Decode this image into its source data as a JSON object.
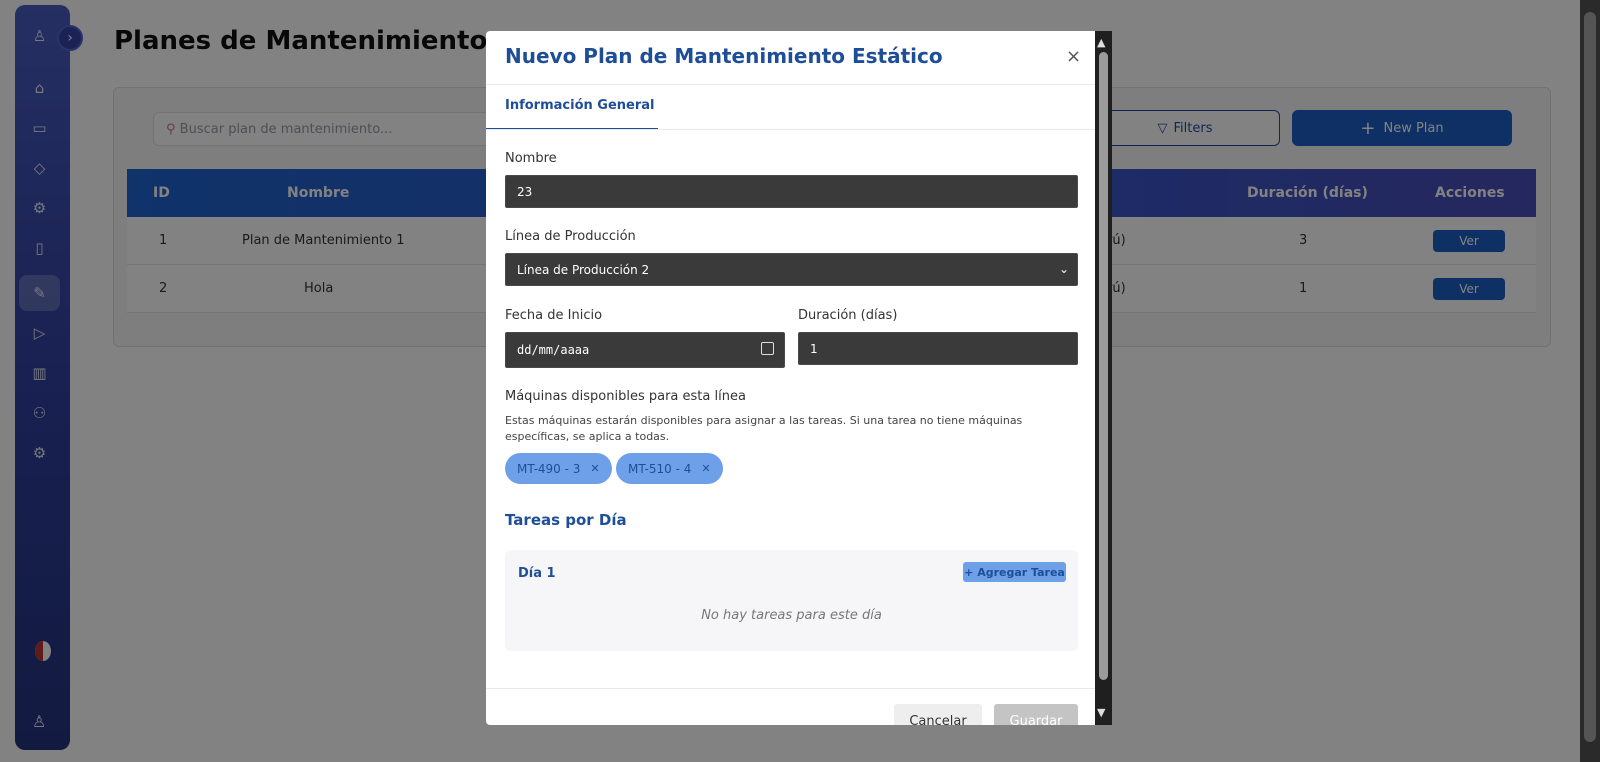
{
  "page": {
    "title": "Planes de Mantenimiento"
  },
  "toolbar": {
    "search_placeholder": "Buscar plan de mantenimiento...",
    "filters_label": "Filters",
    "new_plan_label": "New Plan"
  },
  "table": {
    "columns": [
      "ID",
      "Nombre",
      "Duración (días)",
      "Acciones"
    ],
    "rows": [
      {
        "id": "1",
        "name": "Plan de Mantenimiento 1",
        "partial": "rú)",
        "duration": "3",
        "action": "Ver"
      },
      {
        "id": "2",
        "name": "Hola",
        "partial": "rú)",
        "duration": "1",
        "action": "Ver"
      }
    ]
  },
  "modal": {
    "title": "Nuevo Plan de Mantenimiento Estático",
    "close": "×",
    "tab": "Información General",
    "name_label": "Nombre",
    "name_value": "23",
    "line_label": "Línea de Producción",
    "line_value": "Línea de Producción 2",
    "start_label": "Fecha de Inicio",
    "start_placeholder": "dd/mm/aaaa",
    "duration_label": "Duración (días)",
    "duration_value": "1",
    "machines_label": "Máquinas disponibles para esta línea",
    "machines_help": "Estas máquinas estarán disponibles para asignar a las tareas. Si una tarea no tiene máquinas específicas, se aplica a todas.",
    "machines": [
      "MT-490 - 3",
      "MT-510 - 4"
    ],
    "tasks_title": "Tareas por Día",
    "day_title": "Día 1",
    "add_task": "+ Agregar Tarea",
    "empty_text": "No hay tareas para este día",
    "cancel": "Cancelar",
    "save": "Guardar"
  },
  "colors": {
    "accent": "#1f4e98",
    "primary_button": "#1d5fc7",
    "chip": "#6ea0ea"
  },
  "icons": {
    "sidebar": [
      "robot-icon",
      "home-icon",
      "calendar-icon",
      "box-icon",
      "gear-icon",
      "file-icon",
      "wrench-icon",
      "play-icon",
      "bar-chart-icon",
      "users-icon",
      "settings-icon"
    ]
  }
}
